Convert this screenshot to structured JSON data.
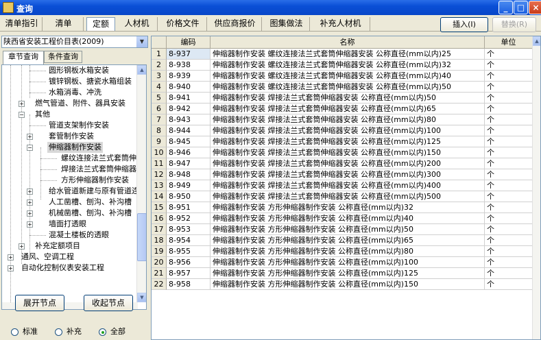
{
  "window": {
    "title": "查询",
    "controls": [
      "_",
      "□",
      "×"
    ]
  },
  "tabs": [
    {
      "label": "清单指引"
    },
    {
      "label": "清单"
    },
    {
      "label": "定额"
    },
    {
      "label": "人材机"
    },
    {
      "label": "价格文件"
    },
    {
      "label": "供应商报价"
    },
    {
      "label": "图集做法"
    },
    {
      "label": "补充人材机"
    }
  ],
  "toolbar": {
    "insert_label": "插入(I)",
    "replace_label": "替换(R)"
  },
  "left": {
    "catalog_select": "陕西省安装工程价目表(2009)",
    "subtabs": [
      "章节查询",
      "条件查询"
    ],
    "tree": [
      {
        "label": "圆形钢板水箱安装"
      },
      {
        "label": "镀锌钢板、搪瓷水箱组装"
      },
      {
        "label": "水箱消毒、冲洗"
      },
      {
        "label": "燃气管道、附件、器具安装"
      },
      {
        "label": "其他"
      },
      {
        "label": "管道支架制作安装"
      },
      {
        "label": "套管制作安装"
      },
      {
        "label": "伸缩器制作安装"
      },
      {
        "label": "螺纹连接法兰式套筒伸缩器安装"
      },
      {
        "label": "焊接法兰式套筒伸缩器安装"
      },
      {
        "label": "方形伸缩器制作安装"
      },
      {
        "label": "给水管道新建与原有管道连接"
      },
      {
        "label": "人工凿槽、刨沟、补沟槽"
      },
      {
        "label": "机械凿槽、刨沟、补沟槽"
      },
      {
        "label": "墙面打透眼"
      },
      {
        "label": "混凝土楼板的透眼"
      },
      {
        "label": "补充定额项目"
      },
      {
        "label": "通风、空调工程"
      },
      {
        "label": "自动化控制仪表安装工程"
      }
    ],
    "expand_button": "展开节点",
    "collapse_button": "收起节点",
    "radios": [
      {
        "label": "标准",
        "checked": false
      },
      {
        "label": "补充",
        "checked": false
      },
      {
        "label": "全部",
        "checked": true
      }
    ]
  },
  "grid": {
    "headers": [
      "编码",
      "名称",
      "单位"
    ],
    "rows": [
      {
        "n": "1",
        "code": "8-937",
        "name": "伸缩器制作安装 螺纹连接法兰式套筒伸缩器安装 公称直径(mm以内)25",
        "unit": "个"
      },
      {
        "n": "2",
        "code": "8-938",
        "name": "伸缩器制作安装 螺纹连接法兰式套筒伸缩器安装 公称直径(mm以内)32",
        "unit": "个"
      },
      {
        "n": "3",
        "code": "8-939",
        "name": "伸缩器制作安装 螺纹连接法兰式套筒伸缩器安装 公称直径(mm以内)40",
        "unit": "个"
      },
      {
        "n": "4",
        "code": "8-940",
        "name": "伸缩器制作安装 螺纹连接法兰式套筒伸缩器安装 公称直径(mm以内)50",
        "unit": "个"
      },
      {
        "n": "5",
        "code": "8-941",
        "name": "伸缩器制作安装 焊接法兰式套筒伸缩器安装 公称直径(mm以内)50",
        "unit": "个"
      },
      {
        "n": "6",
        "code": "8-942",
        "name": "伸缩器制作安装 焊接法兰式套筒伸缩器安装 公称直径(mm以内)65",
        "unit": "个"
      },
      {
        "n": "7",
        "code": "8-943",
        "name": "伸缩器制作安装 焊接法兰式套筒伸缩器安装 公称直径(mm以内)80",
        "unit": "个"
      },
      {
        "n": "8",
        "code": "8-944",
        "name": "伸缩器制作安装 焊接法兰式套筒伸缩器安装 公称直径(mm以内)100",
        "unit": "个"
      },
      {
        "n": "9",
        "code": "8-945",
        "name": "伸缩器制作安装 焊接法兰式套筒伸缩器安装 公称直径(mm以内)125",
        "unit": "个"
      },
      {
        "n": "10",
        "code": "8-946",
        "name": "伸缩器制作安装 焊接法兰式套筒伸缩器安装 公称直径(mm以内)150",
        "unit": "个"
      },
      {
        "n": "11",
        "code": "8-947",
        "name": "伸缩器制作安装 焊接法兰式套筒伸缩器安装 公称直径(mm以内)200",
        "unit": "个"
      },
      {
        "n": "12",
        "code": "8-948",
        "name": "伸缩器制作安装 焊接法兰式套筒伸缩器安装 公称直径(mm以内)300",
        "unit": "个"
      },
      {
        "n": "13",
        "code": "8-949",
        "name": "伸缩器制作安装 焊接法兰式套筒伸缩器安装 公称直径(mm以内)400",
        "unit": "个"
      },
      {
        "n": "14",
        "code": "8-950",
        "name": "伸缩器制作安装 焊接法兰式套筒伸缩器安装 公称直径(mm以内)500",
        "unit": "个"
      },
      {
        "n": "15",
        "code": "8-951",
        "name": "伸缩器制作安装 方形伸缩器制作安装 公称直径(mm以内)32",
        "unit": "个"
      },
      {
        "n": "16",
        "code": "8-952",
        "name": "伸缩器制作安装 方形伸缩器制作安装 公称直径(mm以内)40",
        "unit": "个"
      },
      {
        "n": "17",
        "code": "8-953",
        "name": "伸缩器制作安装 方形伸缩器制作安装 公称直径(mm以内)50",
        "unit": "个"
      },
      {
        "n": "18",
        "code": "8-954",
        "name": "伸缩器制作安装 方形伸缩器制作安装 公称直径(mm以内)65",
        "unit": "个"
      },
      {
        "n": "19",
        "code": "8-955",
        "name": "伸缩器制作安装 方形伸缩器制作安装 公称直径(mm以内)80",
        "unit": "个"
      },
      {
        "n": "20",
        "code": "8-956",
        "name": "伸缩器制作安装 方形伸缩器制作安装 公称直径(mm以内)100",
        "unit": "个"
      },
      {
        "n": "21",
        "code": "8-957",
        "name": "伸缩器制作安装 方形伸缩器制作安装 公称直径(mm以内)125",
        "unit": "个"
      },
      {
        "n": "22",
        "code": "8-958",
        "name": "伸缩器制作安装 方形伸缩器制作安装 公称直径(mm以内)150",
        "unit": "个"
      }
    ]
  }
}
